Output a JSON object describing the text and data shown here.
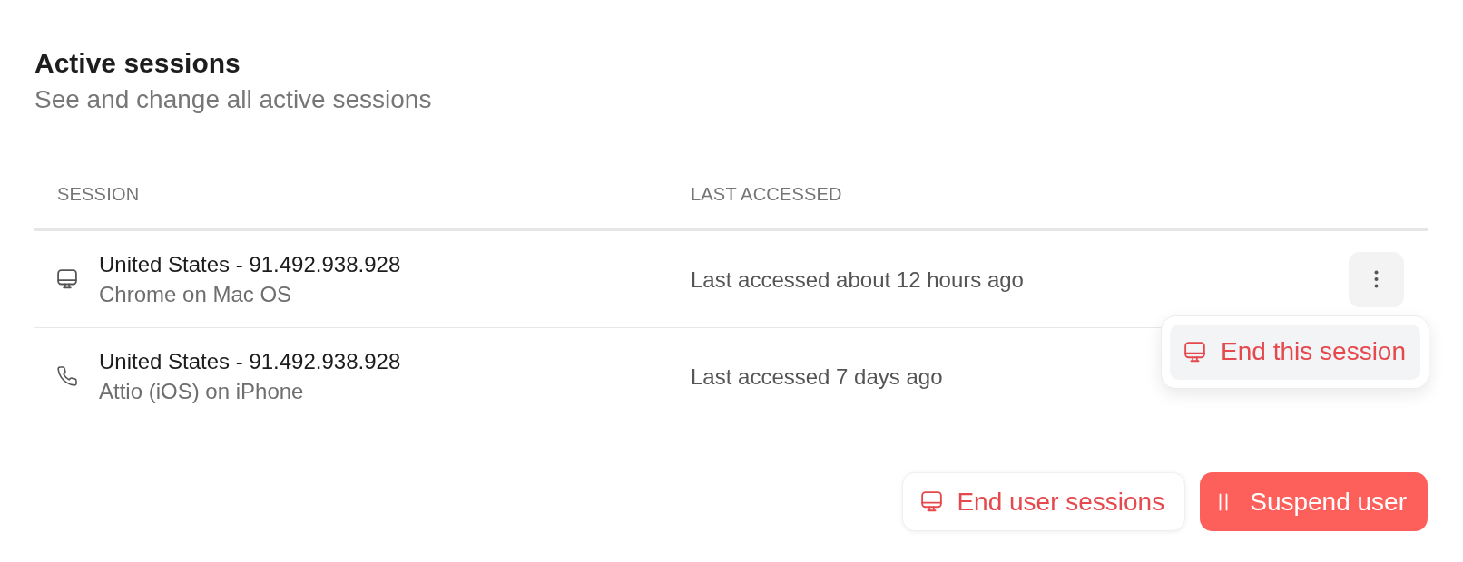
{
  "section": {
    "title": "Active sessions",
    "subtitle": "See and change all active sessions"
  },
  "table": {
    "columns": [
      "SESSION",
      "LAST ACCESSED"
    ],
    "rows": [
      {
        "kind": "desktop",
        "location": "United States - 91.492.938.928",
        "client": "Chrome on Mac OS",
        "last_accessed": "Last accessed about 12 hours ago",
        "menu_open": true
      },
      {
        "kind": "phone",
        "location": "United States - 91.492.938.928",
        "client": "Attio (iOS) on iPhone",
        "last_accessed": "Last accessed 7 days ago",
        "menu_open": false
      }
    ]
  },
  "row_menu": {
    "items": [
      {
        "label": "End this session",
        "kind": "desktop",
        "selected": true
      }
    ]
  },
  "actions": [
    {
      "label": "End user sessions",
      "kind": "secondary"
    },
    {
      "label": "Suspend user",
      "kind": "danger"
    }
  ]
}
